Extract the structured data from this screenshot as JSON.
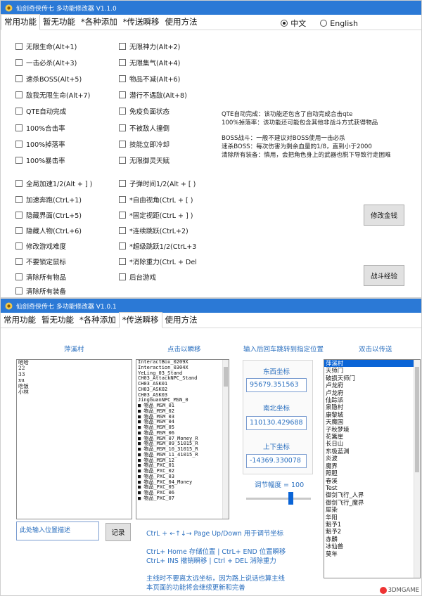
{
  "window1": {
    "title": "仙剑奇侠传七 多功能修改器 V1.1.0",
    "tabs": [
      "常用功能",
      "暂无功能",
      "*各种添加",
      "*传送瞬移",
      "使用方法"
    ],
    "language": {
      "chinese": "中文",
      "english": "English",
      "selected": "中文"
    },
    "cheats_left": [
      "无限生命(Alt+1)",
      "一击必杀(Alt+3)",
      "速杀BOSS(Alt+5)",
      "敌我无限生命(Alt+7)",
      "QTE自动完成",
      "100%合击率",
      "100%掉落率",
      "100%暴击率",
      "全局加速1/2(Alt + ] )",
      "加速奔跑(CtrL+1)",
      "隐藏界面(CtrL+5)",
      "隐藏人物(CtrL+6)",
      "修改游戏难度",
      "不要锁定鼠标",
      "清除所有物品",
      "清除所有装备"
    ],
    "cheats_right": [
      "无限神力(Alt+2)",
      "无限集气(Alt+4)",
      "物品不减(Alt+6)",
      "潜行不遇敌(Alt+8)",
      "免疫负面状态",
      "不被敌人撞倒",
      "技能立即冷却",
      "无限御灵天赋",
      "子弹时间1/2(Alt + [ )",
      "*自由视角(CtrL + [ )",
      "*固定视距(CtrL + ] )",
      "*连续跳跃(CtrL+2)",
      "*超级跳跃1/2(CtrL+3",
      "*消除重力(CtrL + Del",
      "后台游戏"
    ],
    "info_lines": [
      "QTE自动完成：该功能还包含了自动完成合击qte",
      "100%掉落率：该功能还可能包含其他非战斗方式获得物品",
      "",
      "BOSS战斗：一般不建议对BOSS使用一击必杀",
      "速杀BOSS：每次伤害为剩余血量的1/8，直到小于2000",
      "清除所有装备：慎用，会把角色身上的武器也脱下导致行走困难"
    ],
    "buttons": {
      "money": "修改金钱",
      "battle_exp": "战斗经验"
    }
  },
  "window2": {
    "title": "仙剑奇侠传七 多功能修改器 V1.0.1",
    "tabs": [
      "常用功能",
      "暂无功能",
      "*各种添加",
      "*传送瞬移",
      "使用方法"
    ],
    "col_village": "萍溪村",
    "col_click": "点击以瞬移",
    "col_enter": "输入后回车跳转到指定位置",
    "col_dblclick": "双击以传送",
    "saved_positions": [
      "哈哈",
      "22",
      "33",
      "xu",
      "吃饭",
      "小林"
    ],
    "npc_list": [
      "InteractBox_0209X",
      "Interaction_0304X",
      "YeLing_03_Stand",
      "CH03_AttackNPC_Stand",
      "CH03_ASK01",
      "CH03_ASK02",
      "CH03_ASK03",
      "JingGuanNPC_MSN_0",
      "■ 物品_MSM_01",
      "■ 物品_MSM_02",
      "■ 物品_MSM_03",
      "■ 物品_MSM_04",
      "■ 物品_MSM_05",
      "■ 物品_MSM_06",
      "■ 物品_MSM_07_Money_R",
      "■ 物品_MSM_09_51015_R",
      "■ 物品_MSM_10_31015_R",
      "■ 物品_MSM_11_41015_R",
      "■ 物品_MSM_12",
      "■ 物品_PXC_01",
      "■ 物品_PXC_02",
      "■ 物品_PXC_03",
      "■ 物品_PXC_04_Money",
      "■ 物品_PXC_05",
      "■ 物品_PXC_06",
      "■ 物品_PXC_07"
    ],
    "coords": {
      "east_west_label": "东西坐标",
      "east_west_value": "95679.351563",
      "north_south_label": "南北坐标",
      "north_south_value": "110130.429688",
      "up_down_label": "上下坐标",
      "up_down_value": "-14369.330078",
      "step_label": "调节幅度 = 100",
      "slider_level": 0.68
    },
    "locations": [
      "萍溪村",
      "天师门",
      "破损天师门",
      "卢龙府",
      "卢龙府",
      "仙踪派",
      "泉隐村",
      "康黎城",
      "天魔国",
      "子秋梦境",
      "花篱崖",
      "长日山",
      "东极蓝渊",
      "炎波",
      "魔界",
      "照胆",
      "春溪",
      "Test",
      "御剑飞行_人界",
      "御剑飞行_魔界",
      "犀染",
      "华阳",
      "魁予1",
      "魁予2",
      "赤麟",
      "冰仙兽",
      "莫年"
    ],
    "selected_location": "萍溪村",
    "desc_placeholder": "此处输入位置描述",
    "record_button": "记录",
    "help_lines": [
      "CtrL + ←↑↓→  Page Up/Down 用于调节坐标",
      "CtrL+ Home 存储位置  |  CtrL+ END  位置瞬移",
      "CtrL+ INS    撤销瞬移  |  Ctrl + DEL  消除重力",
      "主线时不要离太远坐标，因为路上说话也算主线",
      "本页面的功能将会继续更新和完善"
    ],
    "watermark": "3DMGAME"
  },
  "colors": {
    "titlebar": "#2b79d6",
    "accent_text": "#2a6fbf",
    "selection": "#0a64d6"
  }
}
